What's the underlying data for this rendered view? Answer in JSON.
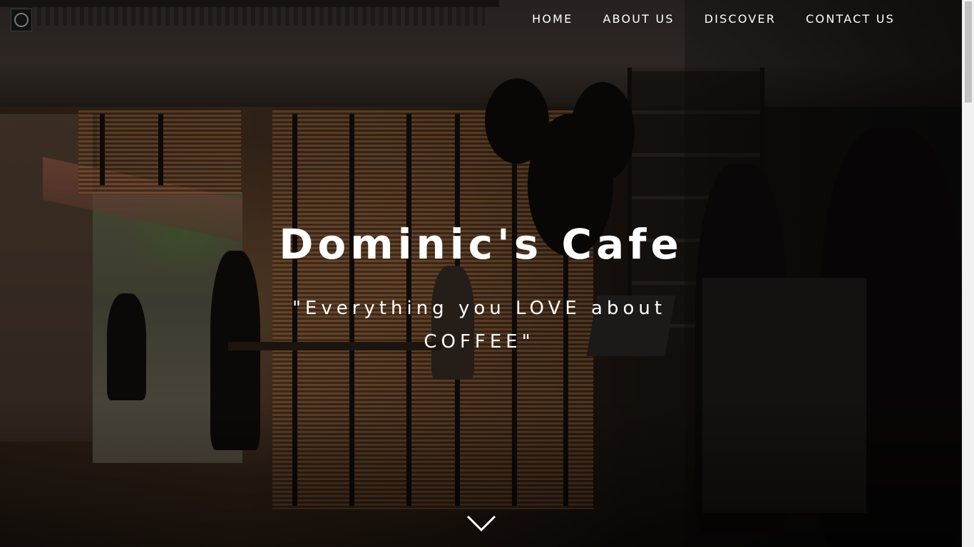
{
  "nav": {
    "items": [
      {
        "label": "HOME"
      },
      {
        "label": "ABOUT US"
      },
      {
        "label": "DISCOVER"
      },
      {
        "label": "CONTACT US"
      }
    ]
  },
  "hero": {
    "title": "Dominic's Cafe",
    "tagline": "\"Everything you LOVE about COFFEE\""
  },
  "icons": {
    "logo": "cafe-logo-icon",
    "scroll": "chevron-down-icon"
  },
  "colors": {
    "text": "#ffffff",
    "overlay": "#000000"
  }
}
